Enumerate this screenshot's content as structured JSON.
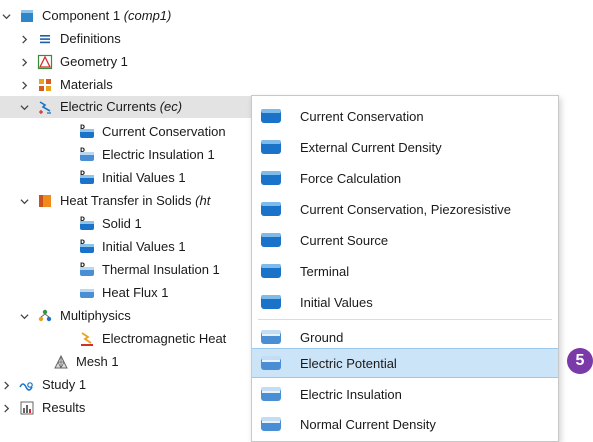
{
  "tree": {
    "component": {
      "label": "Component 1",
      "tag": "(comp1)"
    },
    "definitions": "Definitions",
    "geometry": "Geometry 1",
    "materials": "Materials",
    "electric_currents": {
      "label": "Electric Currents",
      "tag": "(ec)"
    },
    "ec_children": [
      "Current Conservation",
      "Electric Insulation 1",
      "Initial Values 1"
    ],
    "heat_transfer": {
      "label": "Heat Transfer in Solids",
      "tag": "(ht"
    },
    "ht_children": [
      "Solid 1",
      "Initial Values 1",
      "Thermal Insulation 1",
      "Heat Flux 1"
    ],
    "multiphysics": "Multiphysics",
    "em_heating": "Electromagnetic Heat",
    "mesh": "Mesh 1",
    "study": "Study 1",
    "results": "Results"
  },
  "menu": {
    "domain_items": [
      "Current Conservation",
      "External Current Density",
      "Force Calculation",
      "Current Conservation, Piezoresistive",
      "Current Source",
      "Terminal",
      "Initial Values"
    ],
    "boundary_items": [
      "Ground",
      "Electric Potential",
      "Electric Insulation",
      "Normal Current Density"
    ],
    "highlighted": "Electric Potential"
  },
  "badge": "5",
  "colors": {
    "domain_icon": "#1a73c9",
    "boundary_icon": "#4a8fd4",
    "highlight": "#cce4f7",
    "badge": "#7a3aa8"
  }
}
